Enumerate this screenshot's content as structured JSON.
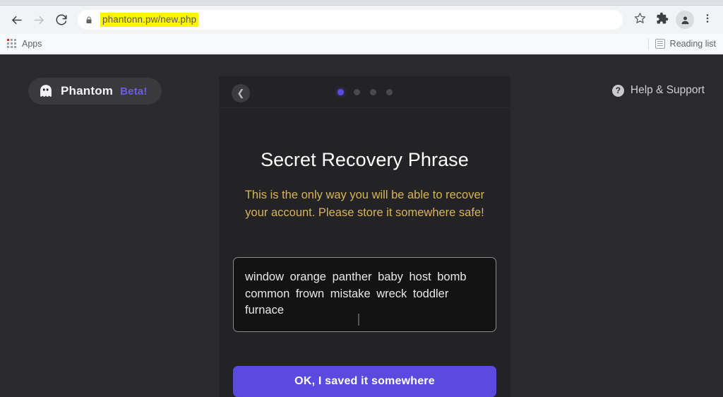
{
  "browser": {
    "back_label": "Back",
    "forward_label": "Forward",
    "reload_label": "Reload",
    "lock_icon": "lock-icon",
    "url": "phantonn.pw/new.php",
    "url_highlight_color": "#fdf400",
    "bookmark_icon": "star-icon",
    "extensions_icon": "puzzle-piece-icon",
    "profile_icon": "avatar-icon",
    "menu_icon": "three-dot-menu-icon",
    "bookmarks": {
      "apps_label": "Apps",
      "reading_list_label": "Reading list"
    }
  },
  "app": {
    "brand": {
      "icon": "ghost-icon",
      "name": "Phantom",
      "beta": "Beta!",
      "beta_color": "#6c5ce7"
    },
    "help": {
      "icon": "question-circle-icon",
      "label": "Help & Support"
    },
    "card": {
      "back_icon": "chevron-left-icon",
      "steps": [
        {
          "active": true
        },
        {
          "active": false
        },
        {
          "active": false
        },
        {
          "active": false
        }
      ],
      "active_step": 1,
      "total_steps": 4,
      "accent_color": "#5b4ae0",
      "title": "Secret Recovery Phrase",
      "warning": "This is the only way you will be able to recover your account. Please store it somewhere safe!",
      "warning_color": "#d7b45a",
      "seed_phrase": "window orange panther baby host bomb common frown mistake wreck toddler furnace",
      "seed_words": [
        "window",
        "orange",
        "panther",
        "baby",
        "host",
        "bomb",
        "common",
        "frown",
        "mistake",
        "wreck",
        "toddler",
        "furnace"
      ],
      "cta_label": "OK, I saved it somewhere"
    }
  }
}
